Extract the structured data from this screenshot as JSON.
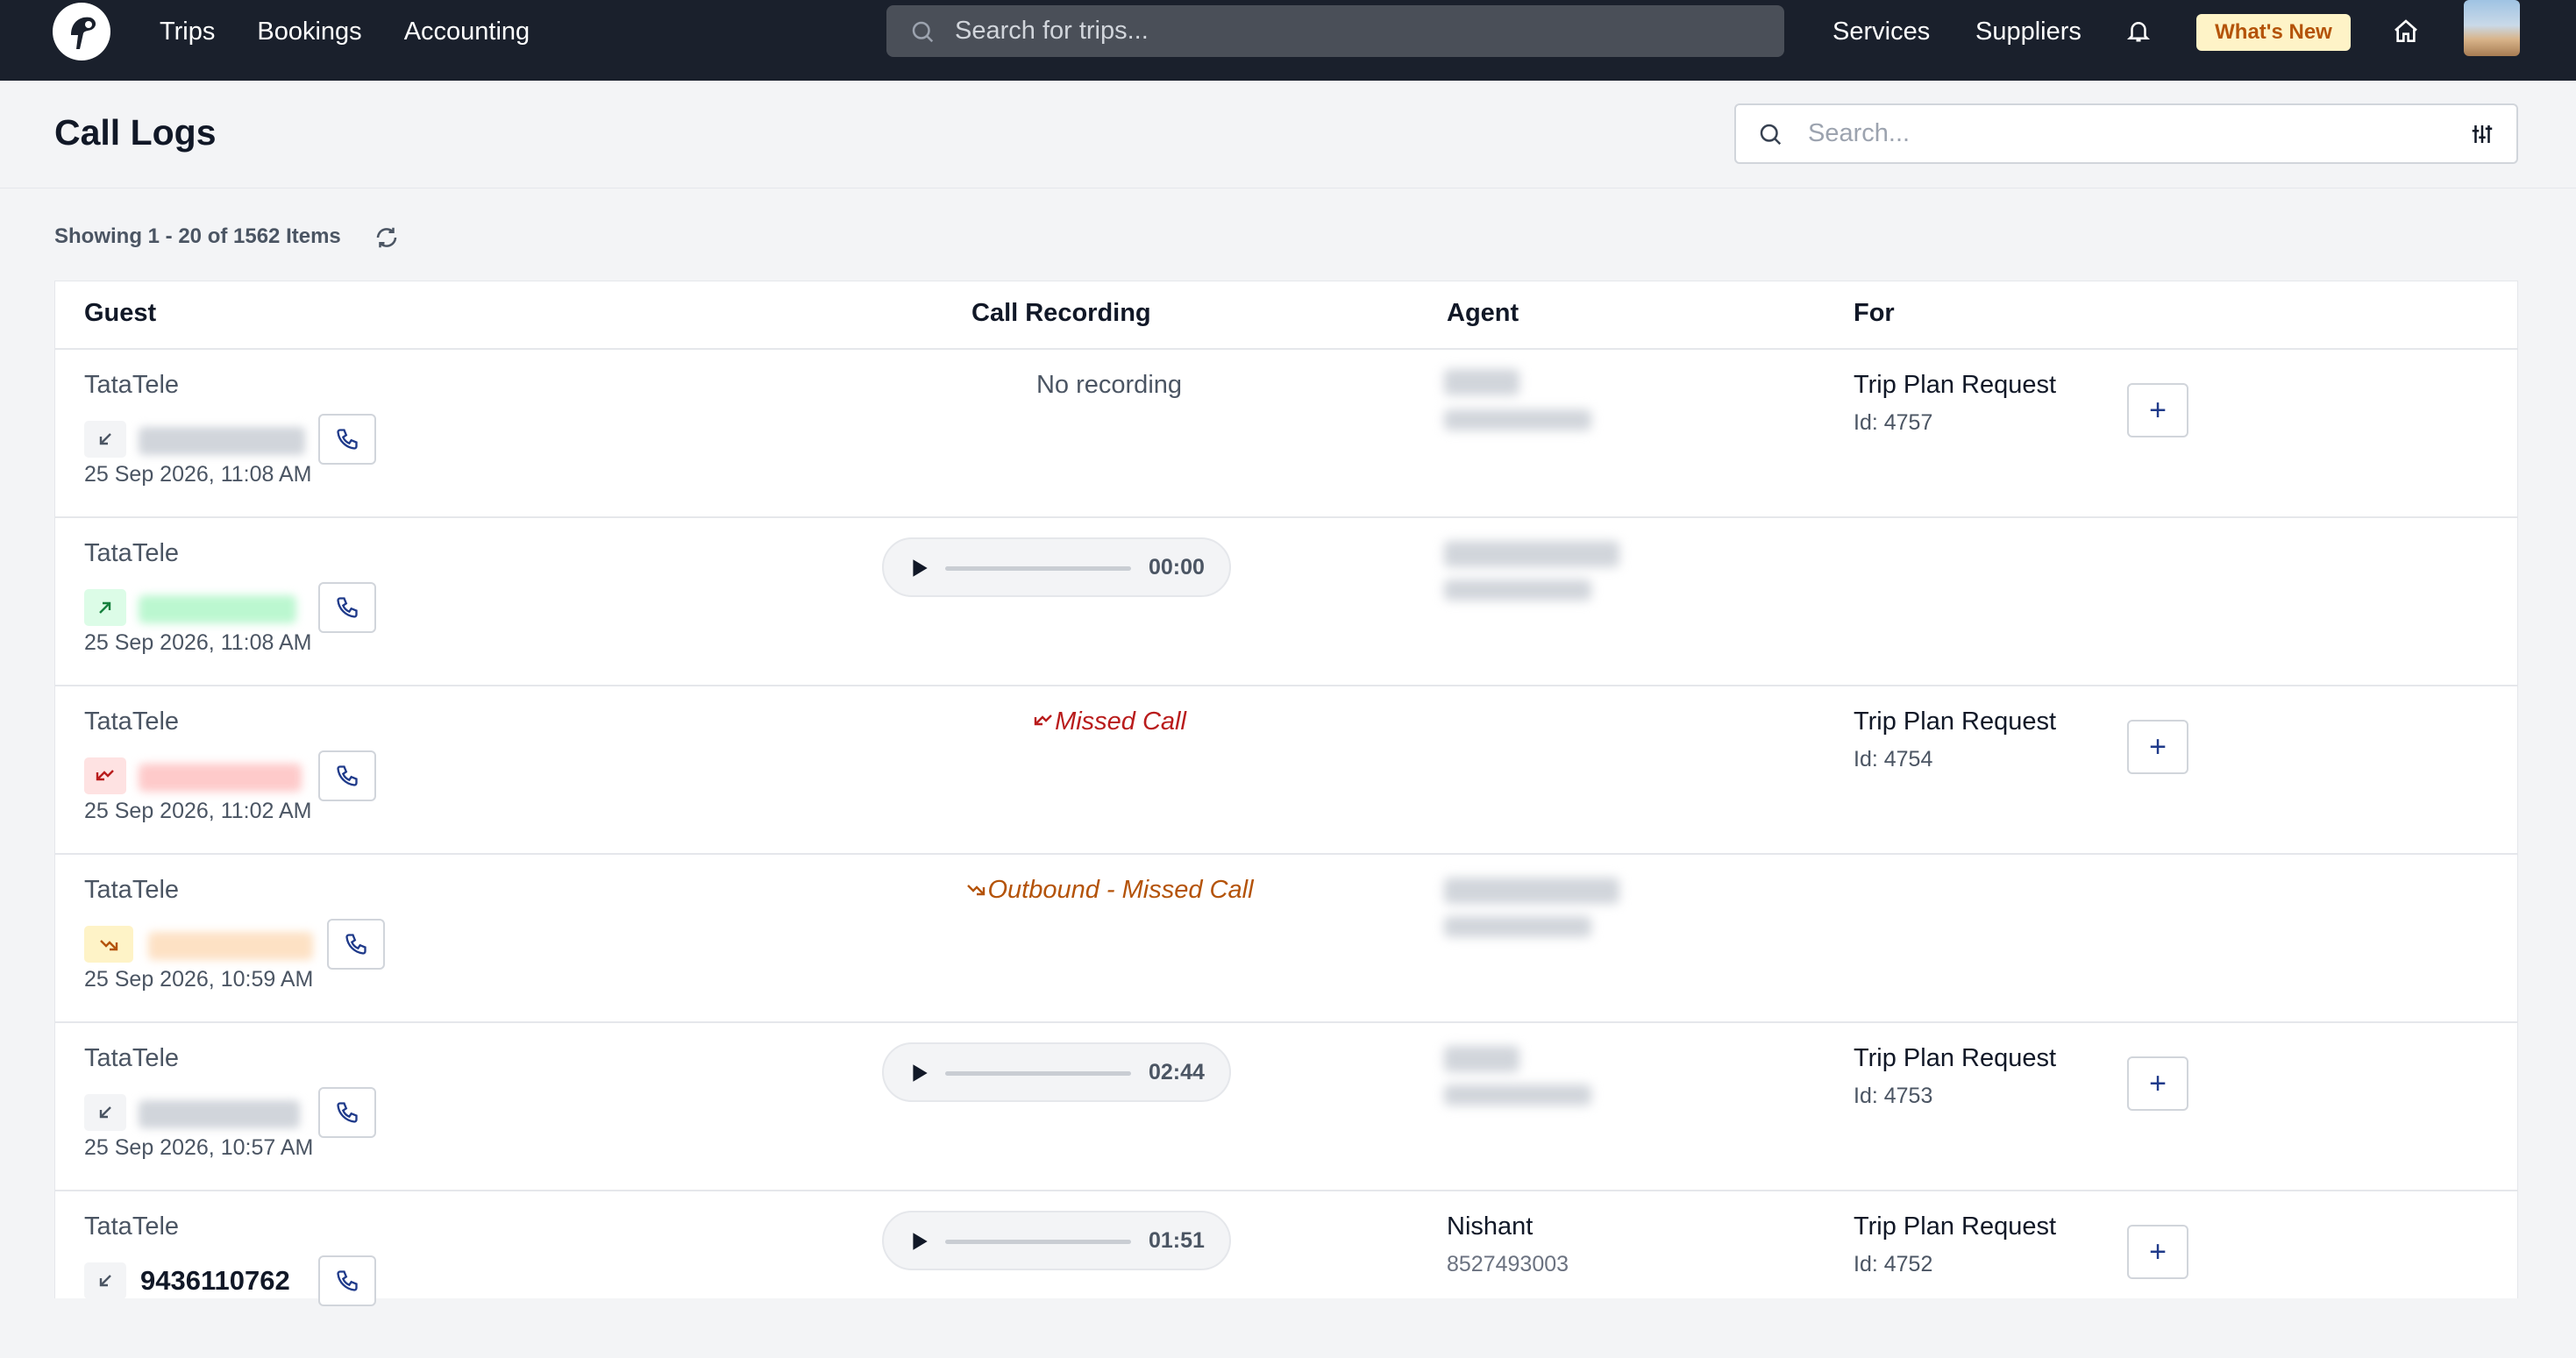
{
  "nav": {
    "links": [
      "Trips",
      "Bookings",
      "Accounting"
    ],
    "search_placeholder": "Search for trips...",
    "right_links": [
      "Services",
      "Suppliers"
    ],
    "whats_new": "What's New"
  },
  "page": {
    "title": "Call Logs",
    "search_placeholder": "Search...",
    "showing": "Showing 1 - 20 of 1562 Items"
  },
  "table": {
    "columns": [
      "Guest",
      "Call Recording",
      "Agent",
      "For"
    ],
    "rows": [
      {
        "provider": "TataTele",
        "direction": "inbound",
        "date": "25 Sep 2026, 11:08 AM",
        "recording": "No recording",
        "for_title": "Trip Plan Request",
        "for_id": "Id: 4757"
      },
      {
        "provider": "TataTele",
        "direction": "outbound",
        "date": "25 Sep 2026, 11:08 AM",
        "recording_time": "00:00"
      },
      {
        "provider": "TataTele",
        "direction": "missed",
        "date": "25 Sep 2026, 11:02 AM",
        "recording": "Missed Call",
        "for_title": "Trip Plan Request",
        "for_id": "Id: 4754"
      },
      {
        "provider": "TataTele",
        "direction": "outbound-missed",
        "date": "25 Sep 2026, 10:59 AM",
        "recording": "Outbound - Missed Call"
      },
      {
        "provider": "TataTele",
        "direction": "inbound",
        "date": "25 Sep 2026, 10:57 AM",
        "recording_time": "02:44",
        "for_title": "Trip Plan Request",
        "for_id": "Id: 4753"
      },
      {
        "provider": "TataTele",
        "direction": "inbound",
        "phone": "9436110762",
        "recording_time": "01:51",
        "agent_name": "Nishant",
        "agent_phone": "8527493003",
        "for_title": "Trip Plan Request",
        "for_id": "Id: 4752"
      }
    ]
  },
  "colors": {
    "nav_bg": "#1a202c",
    "whats_new_bg": "#fef3c7",
    "missed": "#b91c1c",
    "outbound_missed": "#b45309",
    "outbound": "#15803d"
  }
}
